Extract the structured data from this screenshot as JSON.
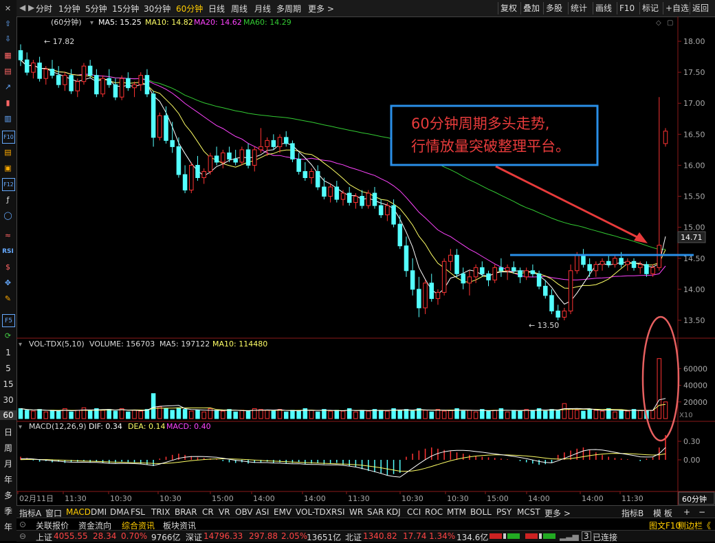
{
  "toolbar": {
    "periods": [
      "分时",
      "1分钟",
      "5分钟",
      "15分钟",
      "30分钟",
      "60分钟",
      "日线",
      "周线",
      "月线",
      "多周期",
      "更多 >"
    ],
    "active_period": "60分钟",
    "right_buttons": [
      "复权",
      "叠加",
      "多股",
      "统计",
      "画线",
      "F10",
      "标记",
      "+自选",
      "返回"
    ]
  },
  "main_chart": {
    "title": "(60分钟)",
    "ma5_label": "MA5: 15.25",
    "ma10_label": "MA10: 14.82",
    "ma20_label": "MA20: 14.62",
    "ma60_label": "MA60: 14.29",
    "price_axis": [
      "18.00",
      "17.50",
      "17.00",
      "16.50",
      "16.00",
      "15.50",
      "15.00",
      "14.50",
      "14.00",
      "13.50"
    ],
    "current_price": "14.71",
    "high_label": "17.82",
    "low_label": "13.50",
    "annotation_line1": "60分钟周期多头走势,",
    "annotation_line2": "行情放量突破整理平台。",
    "colors": {
      "up": "#ff3333",
      "down": "#54ffff",
      "ma5": "#ffffff",
      "ma10": "#ffff66",
      "ma20": "#ff44ff",
      "ma60": "#33cc33",
      "annotation": "#2288ff",
      "arrow": "#e83b3b"
    }
  },
  "volume_chart": {
    "label": "VOL-TDX(5,10)",
    "volume": "VOLUME: 156703",
    "ma5": "MA5: 197122",
    "ma10": "MA10: 114480",
    "axis": [
      "60000",
      "40000",
      "20000"
    ],
    "unit": "X10"
  },
  "macd_chart": {
    "label": "MACD(12,26,9)",
    "dif": "DIF: 0.34",
    "dea": "DEA: 0.14",
    "macd": "MACD: 0.40",
    "axis": [
      "0.30",
      "0.00"
    ]
  },
  "time_axis": [
    "02月11日",
    "11:30",
    "10:30",
    "10:30",
    "15:00",
    "14:00",
    "14:00",
    "11:30",
    "10:30",
    "10:30",
    "15:00",
    "14:00",
    "14:00",
    "11:30"
  ],
  "period_badge": "60分钟",
  "indicator_tabs": [
    "指标A",
    "窗口",
    "MACD",
    "DMI",
    "DMA",
    "FSL",
    "TRIX",
    "BRAR",
    "CR",
    "VR",
    "OBV",
    "ASI",
    "EMV",
    "VOL-TDX",
    "RSI",
    "WR",
    "SAR",
    "KDJ",
    "CCI",
    "ROC",
    "MTM",
    "BOLL",
    "PSY",
    "MCST",
    "更多 >"
  ],
  "active_indicator": "MACD",
  "right_tabs": [
    "指标B",
    "模 板",
    "+",
    "−"
  ],
  "news_tabs": [
    "关联报价",
    "资金流向",
    "综合资讯",
    "板块资讯"
  ],
  "active_news_tab": "综合资讯",
  "status": {
    "sh_label": "上证",
    "sh_value": "4055.55",
    "sh_change": "28.34",
    "sh_pct": "0.70%",
    "sh_amount": "9766亿",
    "sz_label": "深证",
    "sz_value": "14796.33",
    "sz_change": "297.88",
    "sz_pct": "2.05%",
    "sz_amount": "13651亿",
    "nb_label": "北证",
    "nb_value": "1340.82",
    "nb_change": "17.74",
    "nb_pct": "1.34%",
    "nb_amount": "134.6亿",
    "connection": "已连接",
    "connection_count": "3",
    "f10_link": "图文F10",
    "sidebar_link": "侧边栏《"
  },
  "left_periods": [
    "1",
    "5",
    "15",
    "30",
    "60",
    "日",
    "周",
    "月",
    "年",
    "多",
    "季",
    "年"
  ],
  "chart_data": {
    "type": "candlestick",
    "ylim": [
      13.3,
      18.2
    ],
    "bars": [
      [
        17.85,
        17.95,
        17.6,
        17.7
      ],
      [
        17.7,
        17.82,
        17.45,
        17.5
      ],
      [
        17.5,
        17.7,
        17.4,
        17.65
      ],
      [
        17.65,
        17.75,
        17.35,
        17.4
      ],
      [
        17.4,
        17.6,
        17.3,
        17.55
      ],
      [
        17.55,
        17.7,
        17.4,
        17.45
      ],
      [
        17.45,
        17.6,
        17.25,
        17.3
      ],
      [
        17.3,
        17.5,
        17.2,
        17.45
      ],
      [
        17.45,
        17.55,
        17.15,
        17.2
      ],
      [
        17.2,
        17.4,
        17.1,
        17.35
      ],
      [
        17.35,
        17.65,
        17.3,
        17.6
      ],
      [
        17.6,
        17.7,
        17.4,
        17.45
      ],
      [
        17.45,
        17.55,
        17.1,
        17.15
      ],
      [
        17.15,
        17.45,
        17.1,
        17.4
      ],
      [
        17.4,
        17.55,
        17.25,
        17.3
      ],
      [
        17.3,
        17.4,
        17.05,
        17.1
      ],
      [
        17.1,
        17.45,
        17.05,
        17.4
      ],
      [
        17.4,
        17.5,
        17.2,
        17.25
      ],
      [
        17.25,
        17.35,
        17.1,
        17.3
      ],
      [
        17.3,
        17.5,
        17.2,
        17.45
      ],
      [
        17.45,
        17.55,
        17.1,
        17.15
      ],
      [
        17.15,
        17.2,
        16.3,
        16.45
      ],
      [
        16.45,
        16.85,
        16.4,
        16.8
      ],
      [
        16.8,
        16.95,
        16.35,
        16.4
      ],
      [
        16.4,
        16.7,
        16.2,
        16.3
      ],
      [
        16.3,
        16.45,
        15.8,
        15.85
      ],
      [
        15.85,
        16.0,
        15.55,
        15.6
      ],
      [
        15.6,
        16.05,
        15.55,
        16.0
      ],
      [
        16.0,
        16.15,
        15.75,
        15.8
      ],
      [
        15.8,
        15.95,
        15.7,
        15.9
      ],
      [
        15.9,
        16.2,
        15.85,
        16.15
      ],
      [
        16.15,
        16.3,
        16.0,
        16.05
      ],
      [
        16.05,
        16.25,
        15.95,
        16.2
      ],
      [
        16.2,
        16.3,
        16.05,
        16.1
      ],
      [
        16.1,
        16.25,
        16.0,
        16.05
      ],
      [
        16.05,
        16.3,
        16.0,
        16.25
      ],
      [
        16.25,
        16.35,
        15.95,
        16.0
      ],
      [
        16.0,
        16.3,
        15.9,
        16.25
      ],
      [
        16.25,
        16.6,
        16.2,
        16.3
      ],
      [
        16.3,
        16.45,
        16.15,
        16.4
      ],
      [
        16.4,
        16.5,
        16.25,
        16.3
      ],
      [
        16.3,
        16.5,
        16.2,
        16.45
      ],
      [
        16.45,
        16.55,
        16.3,
        16.35
      ],
      [
        16.35,
        16.4,
        16.05,
        16.1
      ],
      [
        16.1,
        16.2,
        15.85,
        15.9
      ],
      [
        15.9,
        16.05,
        15.75,
        15.8
      ],
      [
        15.8,
        15.95,
        15.7,
        15.9
      ],
      [
        15.9,
        16.0,
        15.6,
        15.65
      ],
      [
        15.65,
        15.8,
        15.45,
        15.5
      ],
      [
        15.5,
        15.7,
        15.4,
        15.65
      ],
      [
        15.65,
        15.75,
        15.4,
        15.45
      ],
      [
        15.45,
        15.6,
        15.35,
        15.55
      ],
      [
        15.55,
        15.65,
        15.35,
        15.4
      ],
      [
        15.4,
        15.55,
        15.3,
        15.5
      ],
      [
        15.5,
        15.6,
        15.3,
        15.35
      ],
      [
        15.35,
        15.6,
        15.3,
        15.55
      ],
      [
        15.55,
        15.65,
        15.3,
        15.35
      ],
      [
        15.35,
        15.45,
        15.15,
        15.2
      ],
      [
        15.2,
        15.4,
        15.1,
        15.35
      ],
      [
        15.35,
        15.45,
        15.0,
        15.05
      ],
      [
        15.05,
        15.2,
        14.65,
        14.7
      ],
      [
        14.7,
        14.85,
        14.2,
        14.3
      ],
      [
        14.3,
        14.5,
        13.9,
        14.0
      ],
      [
        14.0,
        14.2,
        13.55,
        13.7
      ],
      [
        13.7,
        14.15,
        13.6,
        14.1
      ],
      [
        14.1,
        14.25,
        13.8,
        13.85
      ],
      [
        13.85,
        14.0,
        13.75,
        13.95
      ],
      [
        13.95,
        14.5,
        13.9,
        14.45
      ],
      [
        14.45,
        14.65,
        14.3,
        14.55
      ],
      [
        14.55,
        14.65,
        14.2,
        14.25
      ],
      [
        14.25,
        14.35,
        14.0,
        14.1
      ],
      [
        14.1,
        14.3,
        13.9,
        14.2
      ],
      [
        14.2,
        14.4,
        14.1,
        14.35
      ],
      [
        14.35,
        14.45,
        14.2,
        14.25
      ],
      [
        14.25,
        14.3,
        14.05,
        14.15
      ],
      [
        14.15,
        14.4,
        14.1,
        14.35
      ],
      [
        14.35,
        14.5,
        14.2,
        14.3
      ],
      [
        14.3,
        14.4,
        14.15,
        14.35
      ],
      [
        14.35,
        14.45,
        14.25,
        14.3
      ],
      [
        14.3,
        14.35,
        14.1,
        14.2
      ],
      [
        14.2,
        14.35,
        14.15,
        14.3
      ],
      [
        14.3,
        14.4,
        14.2,
        14.25
      ],
      [
        14.25,
        14.3,
        14.0,
        14.05
      ],
      [
        14.05,
        14.15,
        13.85,
        13.9
      ],
      [
        13.9,
        14.0,
        13.6,
        13.65
      ],
      [
        13.65,
        13.75,
        13.5,
        13.55
      ],
      [
        13.55,
        13.7,
        13.5,
        13.65
      ],
      [
        13.65,
        14.4,
        13.6,
        14.3
      ],
      [
        14.3,
        14.6,
        14.25,
        14.55
      ],
      [
        14.55,
        14.65,
        14.35,
        14.4
      ],
      [
        14.4,
        14.5,
        14.2,
        14.3
      ],
      [
        14.3,
        14.45,
        14.2,
        14.4
      ],
      [
        14.4,
        14.5,
        14.3,
        14.45
      ],
      [
        14.45,
        14.55,
        14.35,
        14.4
      ],
      [
        14.4,
        14.55,
        14.35,
        14.5
      ],
      [
        14.5,
        14.6,
        14.35,
        14.4
      ],
      [
        14.4,
        14.5,
        14.3,
        14.45
      ],
      [
        14.45,
        14.5,
        14.3,
        14.35
      ],
      [
        14.35,
        14.45,
        14.25,
        14.4
      ],
      [
        14.4,
        14.45,
        14.2,
        14.25
      ],
      [
        14.25,
        14.4,
        14.2,
        14.35
      ],
      [
        14.35,
        17.1,
        14.3,
        14.71
      ],
      [
        16.35,
        16.6,
        16.3,
        16.55
      ]
    ],
    "volumes": [
      12,
      10,
      9,
      11,
      8,
      10,
      9,
      12,
      8,
      10,
      13,
      9,
      12,
      10,
      11,
      9,
      12,
      8,
      10,
      9,
      11,
      30,
      14,
      12,
      10,
      13,
      11,
      9,
      10,
      8,
      12,
      10,
      9,
      11,
      8,
      10,
      9,
      12,
      11,
      10,
      9,
      11,
      8,
      10,
      9,
      12,
      10,
      8,
      11,
      9,
      10,
      9,
      12,
      8,
      10,
      9,
      11,
      10,
      9,
      12,
      10,
      11,
      9,
      12,
      10,
      8,
      11,
      9,
      10,
      12,
      9,
      10,
      8,
      11,
      9,
      10,
      12,
      8,
      10,
      9,
      11,
      10,
      12,
      9,
      11,
      10,
      18,
      12,
      10,
      9,
      11,
      10,
      9,
      12,
      8,
      10,
      9,
      11,
      10,
      9,
      10,
      72,
      20
    ],
    "macd": [
      0.05,
      0.03,
      -0.01,
      -0.03,
      -0.02,
      -0.04,
      -0.03,
      -0.05,
      -0.04,
      -0.03,
      -0.02,
      -0.04,
      -0.03,
      -0.05,
      -0.06,
      -0.05,
      -0.03,
      -0.04,
      -0.05,
      -0.06,
      -0.08,
      -0.1,
      0.02,
      0.05,
      0.08,
      0.1,
      0.08,
      0.06,
      0.04,
      0.03,
      0.02,
      0.01,
      -0.02,
      -0.04,
      -0.05,
      -0.04,
      -0.06,
      -0.05,
      -0.04,
      -0.03,
      -0.05,
      -0.04,
      -0.06,
      -0.05,
      -0.04,
      -0.07,
      -0.06,
      -0.05,
      -0.07,
      -0.06,
      -0.05,
      -0.08,
      -0.1,
      -0.12,
      -0.15,
      -0.18,
      -0.2,
      -0.22,
      -0.25,
      -0.23,
      -0.21,
      0.05,
      0.1,
      0.15,
      0.18,
      0.2,
      0.18,
      0.16,
      0.14,
      0.12,
      0.1,
      0.08,
      0.06,
      0.05,
      0.04,
      0.03,
      0.02,
      0.01,
      0.0,
      -0.02,
      -0.04,
      -0.06,
      -0.08,
      -0.07,
      -0.05,
      0.08,
      0.12,
      0.15,
      0.18,
      0.2,
      0.16,
      0.12,
      0.08,
      0.05,
      0.03,
      0.02,
      0.01,
      0.0,
      -0.02,
      0.02,
      0.04,
      0.2,
      0.4
    ]
  }
}
